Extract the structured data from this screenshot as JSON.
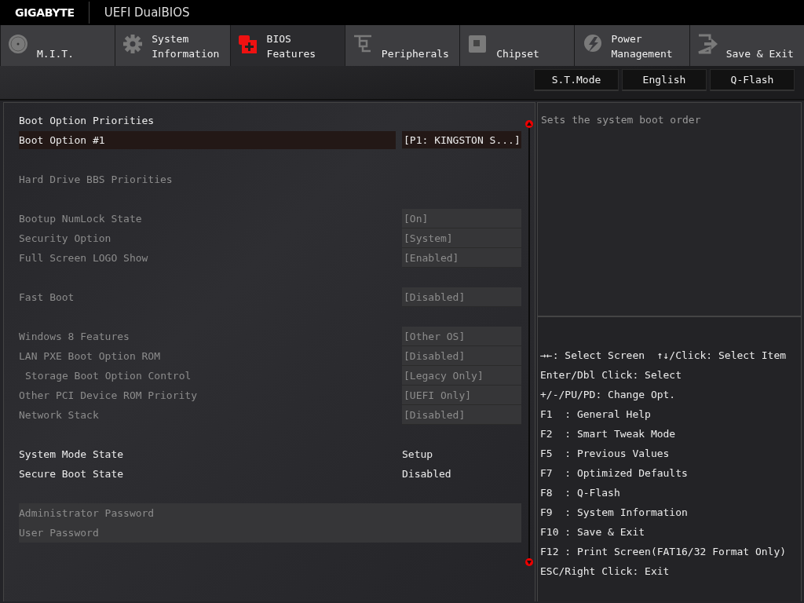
{
  "header": {
    "brand": "GIGABYTE",
    "title": "UEFI DualBIOS"
  },
  "tabs": [
    {
      "label": "M.I.T.",
      "selected": false
    },
    {
      "label": "System Information",
      "selected": false
    },
    {
      "label": "BIOS Features",
      "selected": true
    },
    {
      "label": "Peripherals",
      "selected": false
    },
    {
      "label": "Chipset",
      "selected": false
    },
    {
      "label": "Power Management",
      "selected": false
    },
    {
      "label": "Save & Exit",
      "selected": false
    }
  ],
  "toolbar": [
    "S.T.Mode",
    "English",
    "Q-Flash"
  ],
  "settings": [
    {
      "rows": [
        {
          "kind": "heading",
          "label": "Boot Option Priorities"
        },
        {
          "kind": "option",
          "label": "Boot Option #1",
          "value": "[P1: KINGSTON S...]",
          "selected": true,
          "disabled": false,
          "indented": false
        }
      ]
    },
    {
      "rows": [
        {
          "kind": "link",
          "label": "Hard Drive BBS Priorities",
          "selected": false,
          "disabled": true,
          "indented": false
        }
      ]
    },
    {
      "rows": [
        {
          "kind": "option",
          "label": "Bootup NumLock State",
          "value": "[On]",
          "selected": false,
          "disabled": true,
          "indented": false
        },
        {
          "kind": "option",
          "label": "Security Option",
          "value": "[System]",
          "selected": false,
          "disabled": true,
          "indented": false
        },
        {
          "kind": "option",
          "label": "Full Screen LOGO Show",
          "value": "[Enabled]",
          "selected": false,
          "disabled": true,
          "indented": false
        }
      ]
    },
    {
      "rows": [
        {
          "kind": "option",
          "label": "Fast Boot",
          "value": "[Disabled]",
          "selected": false,
          "disabled": true,
          "indented": false
        }
      ]
    },
    {
      "rows": [
        {
          "kind": "option",
          "label": "Windows 8 Features",
          "value": "[Other OS]",
          "selected": false,
          "disabled": true,
          "indented": false
        },
        {
          "kind": "option",
          "label": "LAN PXE Boot Option ROM",
          "value": "[Disabled]",
          "selected": false,
          "disabled": true,
          "indented": false
        },
        {
          "kind": "option",
          "label": "Storage Boot Option Control",
          "value": "[Legacy Only]",
          "selected": false,
          "disabled": true,
          "indented": true
        },
        {
          "kind": "option",
          "label": "Other PCI Device ROM Priority",
          "value": "[UEFI Only]",
          "selected": false,
          "disabled": true,
          "indented": false
        },
        {
          "kind": "option",
          "label": "Network Stack",
          "value": "[Disabled]",
          "selected": false,
          "disabled": true,
          "indented": false
        }
      ]
    },
    {
      "rows": [
        {
          "kind": "info",
          "label": "System Mode State",
          "value": "Setup"
        },
        {
          "kind": "info",
          "label": "Secure Boot State",
          "value": "Disabled"
        }
      ]
    },
    {
      "rows": [
        {
          "kind": "password",
          "label": "Administrator Password",
          "selected": false,
          "disabled": true,
          "indented": false
        },
        {
          "kind": "password",
          "label": "User Password",
          "selected": false,
          "disabled": true,
          "indented": false
        }
      ]
    }
  ],
  "description": "Sets the system boot order",
  "help": [
    "→←: Select Screen  ↑↓/Click: Select Item",
    "Enter/Dbl Click: Select",
    "+/-/PU/PD: Change Opt.",
    "F1  : General Help",
    "F2  : Smart Tweak Mode",
    "F5  : Previous Values",
    "F7  : Optimized Defaults",
    "F8  : Q-Flash",
    "F9  : System Information",
    "F10 : Save & Exit",
    "F12 : Print Screen(FAT16/32 Format Only)",
    "ESC/Right Click: Exit"
  ]
}
